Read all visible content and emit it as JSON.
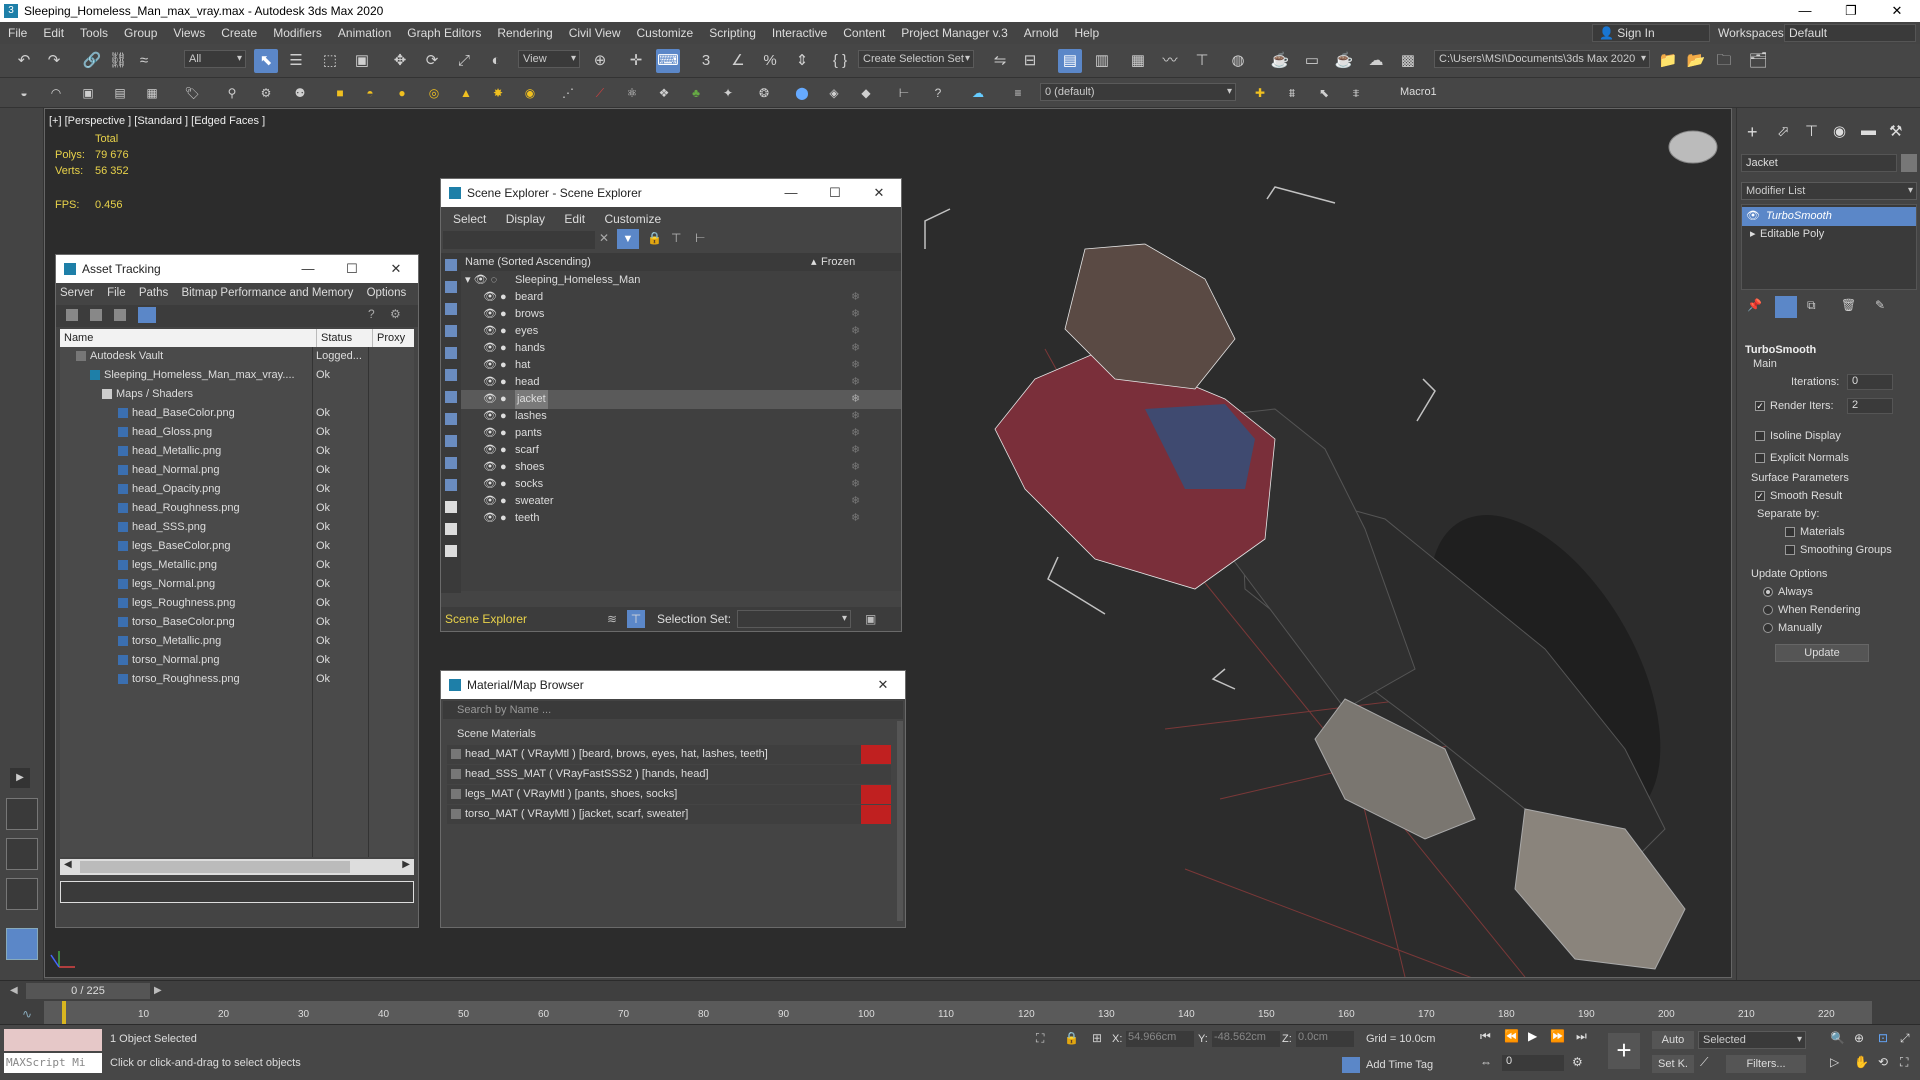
{
  "window": {
    "title": "Sleeping_Homeless_Man_max_vray.max - Autodesk 3ds Max 2020"
  },
  "menu": [
    "File",
    "Edit",
    "Tools",
    "Group",
    "Views",
    "Create",
    "Modifiers",
    "Animation",
    "Graph Editors",
    "Rendering",
    "Civil View",
    "Customize",
    "Scripting",
    "Interactive",
    "Content",
    "Project Manager v.3",
    "Arnold",
    "Help"
  ],
  "account": {
    "signin": "Sign In",
    "workspaces_label": "Workspaces:",
    "workspace": "Default"
  },
  "toolbar": {
    "filter": "All",
    "view": "View",
    "selection_set": "Create Selection Set",
    "path": "C:\\Users\\MSI\\Documents\\3ds Max 2020",
    "layer": "0 (default)",
    "macro": "Macro1"
  },
  "viewport": {
    "label": "[+] [Perspective ] [Standard ] [Edged Faces ]",
    "total": "Total",
    "polys_label": "Polys:",
    "polys": "79 676",
    "verts_label": "Verts:",
    "verts": "56 352",
    "fps_label": "FPS:",
    "fps": "0.456"
  },
  "asset_tracking": {
    "title": "Asset Tracking",
    "menu": [
      "Server",
      "File",
      "Paths",
      "Bitmap Performance and Memory",
      "Options"
    ],
    "columns": [
      "Name",
      "Status",
      "Proxy R."
    ],
    "rows": [
      {
        "name": "Autodesk Vault",
        "status": "Logged..."
      },
      {
        "name": "Sleeping_Homeless_Man_max_vray....",
        "status": "Ok"
      },
      {
        "name": "Maps / Shaders",
        "status": ""
      },
      {
        "name": "head_BaseColor.png",
        "status": "Ok"
      },
      {
        "name": "head_Gloss.png",
        "status": "Ok"
      },
      {
        "name": "head_Metallic.png",
        "status": "Ok"
      },
      {
        "name": "head_Normal.png",
        "status": "Ok"
      },
      {
        "name": "head_Opacity.png",
        "status": "Ok"
      },
      {
        "name": "head_Roughness.png",
        "status": "Ok"
      },
      {
        "name": "head_SSS.png",
        "status": "Ok"
      },
      {
        "name": "legs_BaseColor.png",
        "status": "Ok"
      },
      {
        "name": "legs_Metallic.png",
        "status": "Ok"
      },
      {
        "name": "legs_Normal.png",
        "status": "Ok"
      },
      {
        "name": "legs_Roughness.png",
        "status": "Ok"
      },
      {
        "name": "torso_BaseColor.png",
        "status": "Ok"
      },
      {
        "name": "torso_Metallic.png",
        "status": "Ok"
      },
      {
        "name": "torso_Normal.png",
        "status": "Ok"
      },
      {
        "name": "torso_Roughness.png",
        "status": "Ok"
      }
    ]
  },
  "scene_explorer": {
    "title": "Scene Explorer - Scene Explorer",
    "menu": [
      "Select",
      "Display",
      "Edit",
      "Customize"
    ],
    "col_name": "Name (Sorted Ascending)",
    "col_frozen": "Frozen",
    "root": "Sleeping_Homeless_Man",
    "items": [
      "beard",
      "brows",
      "eyes",
      "hands",
      "hat",
      "head",
      "jacket",
      "lashes",
      "pants",
      "scarf",
      "shoes",
      "socks",
      "sweater",
      "teeth"
    ],
    "selected": "jacket",
    "footer_label": "Scene Explorer",
    "selection_set_label": "Selection Set:"
  },
  "material_browser": {
    "title": "Material/Map Browser",
    "search_placeholder": "Search by Name ...",
    "group": "Scene Materials",
    "materials": [
      "head_MAT  ( VRayMtl )  [beard, brows, eyes, hat, lashes, teeth]",
      "head_SSS_MAT  ( VRayFastSSS2 )  [hands, head]",
      "legs_MAT  ( VRayMtl )  [pants, shoes, socks]",
      "torso_MAT  ( VRayMtl )  [jacket, scarf, sweater]"
    ]
  },
  "modify_panel": {
    "object_name": "Jacket",
    "modifier_list": "Modifier List",
    "stack": [
      "TurboSmooth",
      "Editable Poly"
    ],
    "rollout": "TurboSmooth",
    "main": "Main",
    "iterations_label": "Iterations:",
    "iterations": "0",
    "render_iters_label": "Render Iters:",
    "render_iters": "2",
    "isoline": "Isoline Display",
    "explicit_normals": "Explicit Normals",
    "surface_params": "Surface Parameters",
    "smooth_result": "Smooth Result",
    "separate_by": "Separate by:",
    "materials": "Materials",
    "smoothing_groups": "Smoothing Groups",
    "update_options": "Update Options",
    "always": "Always",
    "when_rendering": "When Rendering",
    "manually": "Manually",
    "update_btn": "Update"
  },
  "timeline": {
    "frame": "0 / 225",
    "ticks": [
      "10",
      "20",
      "30",
      "40",
      "50",
      "60",
      "70",
      "80",
      "90",
      "100",
      "110",
      "120",
      "130",
      "140",
      "150",
      "160",
      "170",
      "180",
      "190",
      "200",
      "210",
      "220"
    ]
  },
  "status": {
    "maxscript": "MAXScript Mi",
    "selected": "1 Object Selected",
    "prompt": "Click or click-and-drag to select objects",
    "x_label": "X:",
    "x": "54.966cm",
    "y_label": "Y:",
    "y": "-48.562cm",
    "z_label": "Z:",
    "z": "0.0cm",
    "grid": "Grid = 10.0cm",
    "add_time_tag": "Add Time Tag",
    "auto": "Auto",
    "set_k": "Set K.",
    "key_mode": "Selected",
    "filters": "Filters...",
    "frame_field": "0"
  }
}
